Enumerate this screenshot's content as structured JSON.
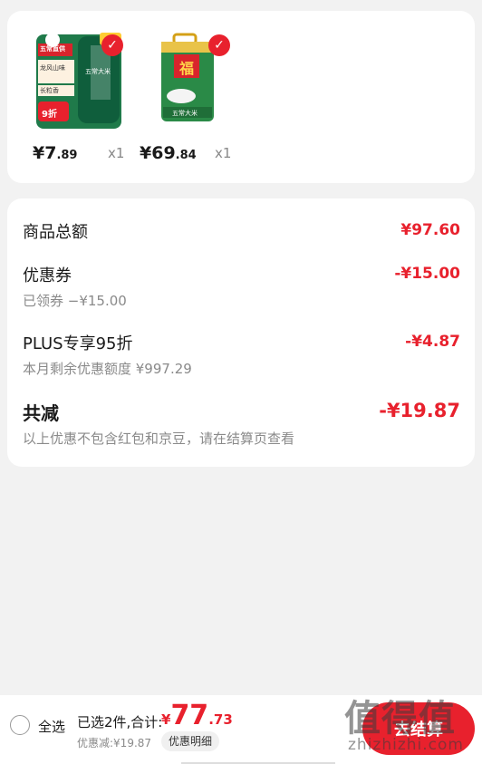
{
  "products": [
    {
      "price_int": "¥7",
      "price_dec": ".89",
      "qty": "x1",
      "image_text": [
        "五常直供",
        "龙风山味",
        "长粒香",
        "9折",
        "五常大米"
      ]
    },
    {
      "price_int": "¥69",
      "price_dec": ".84",
      "qty": "x1",
      "image_text": [
        "福",
        "五常大米"
      ]
    }
  ],
  "summary": {
    "goods_total_label": "商品总额",
    "goods_total_value": "¥97.60",
    "coupon_label": "优惠券",
    "coupon_value": "-¥15.00",
    "coupon_sub": "已领券 −¥15.00",
    "plus_label": "PLUS专享95折",
    "plus_value": "-¥4.87",
    "plus_sub": "本月剩余优惠额度 ¥997.29",
    "total_reduce_label": "共减",
    "total_reduce_value": "-¥19.87",
    "total_reduce_note": "以上优惠不包含红包和京豆，请在结算页查看"
  },
  "bottom": {
    "select_all": "全选",
    "selected_text": "已选2件,合计:",
    "total_currency": "¥",
    "total_int": "77",
    "total_dec": ".73",
    "discount_line": "优惠减:¥19.87",
    "detail_button": "优惠明细",
    "checkout_button": "去结算"
  },
  "watermark": {
    "big": "值得值",
    "small": "zhizhizhi.com"
  },
  "colors": {
    "accent": "#e8212d",
    "background": "#f2f2f2"
  }
}
